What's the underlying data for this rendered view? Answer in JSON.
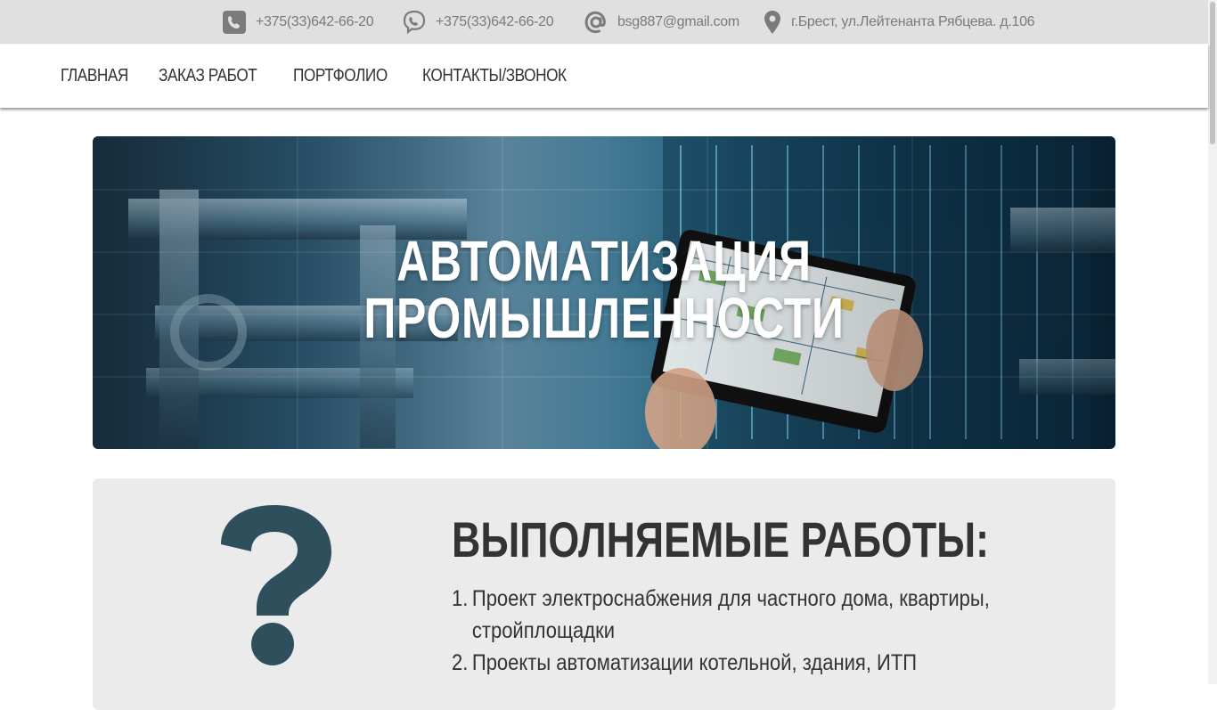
{
  "topbar": {
    "contacts": [
      {
        "icon": "phone-icon",
        "text": "+375(33)642-66-20"
      },
      {
        "icon": "viber-icon",
        "text": "+375(33)642-66-20"
      },
      {
        "icon": "at-sign-icon",
        "text": "bsg887@gmail.com"
      },
      {
        "icon": "map-pin-icon",
        "text": "г.Брест, ул.Лейтенанта Рябцева. д.106"
      }
    ]
  },
  "nav": {
    "items": [
      "ГЛАВНАЯ",
      "ЗАКАЗ РАБОТ",
      "ПОРТФОЛИО",
      "КОНТАКТЫ/ЗВОНОК"
    ]
  },
  "hero": {
    "title_line1": "АВТОМАТИЗАЦИЯ",
    "title_line2": "ПРОМЫШЛЕННОСТИ"
  },
  "works": {
    "icon": "question-mark-icon",
    "heading": "ВЫПОЛНЯЕМЫЕ РАБОТЫ:",
    "items": [
      {
        "num": "1.",
        "text": "Проект электроснабжения для частного дома, квартиры, стройплощадки"
      },
      {
        "num": "2.",
        "text": "Проекты автоматизации котельной, здания, ИТП"
      }
    ]
  },
  "colors": {
    "topbar_bg": "#e0e0e0",
    "icon_gray": "#7b7b7b",
    "question_mark": "#2f4f5c",
    "panel_bg": "#ebebeb"
  }
}
